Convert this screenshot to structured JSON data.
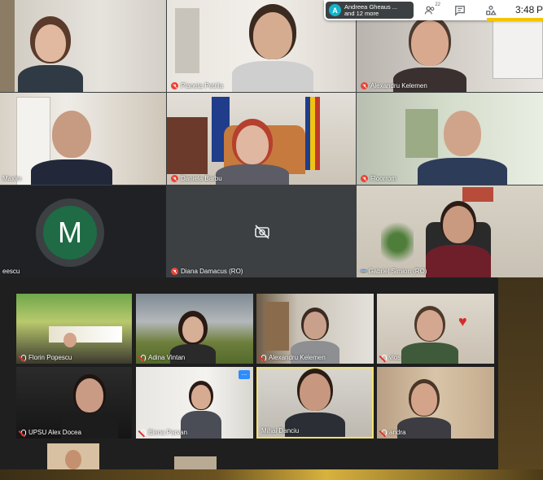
{
  "meet": {
    "presenter": {
      "initial": "A",
      "line1": "Andreea Gheaus ...",
      "line2": "and 12 more"
    },
    "people_count": "22",
    "time": "3:48",
    "time_suffix": "P",
    "tiles": [
      {
        "name": ""
      },
      {
        "name": "Planeta Petrila"
      },
      {
        "name": "Alexandru Kelemen"
      },
      {
        "name": "Maxim"
      },
      {
        "name": "Daniela Barbu"
      },
      {
        "name": "Floorrom"
      },
      {
        "name": "eescu",
        "initial": "M"
      },
      {
        "name": "Diana Damacus (RO)"
      },
      {
        "name": "Gabriel Simion (RO)"
      }
    ]
  },
  "zoom": {
    "tiles": [
      {
        "name": "Florin Popescu"
      },
      {
        "name": "Adina Vintan"
      },
      {
        "name": "Alexandru Kelemen"
      },
      {
        "name": "vios"
      },
      {
        "name": "UPSU Alex Docea"
      },
      {
        "name": "Elena Parvan"
      },
      {
        "name": "Mihai Danciu"
      },
      {
        "name": "andra"
      }
    ],
    "more_button": "..."
  },
  "colors": {
    "mute": "#ea4335",
    "active_speaker": "#f3e26b",
    "avatar_bg": "#1e6b45"
  }
}
